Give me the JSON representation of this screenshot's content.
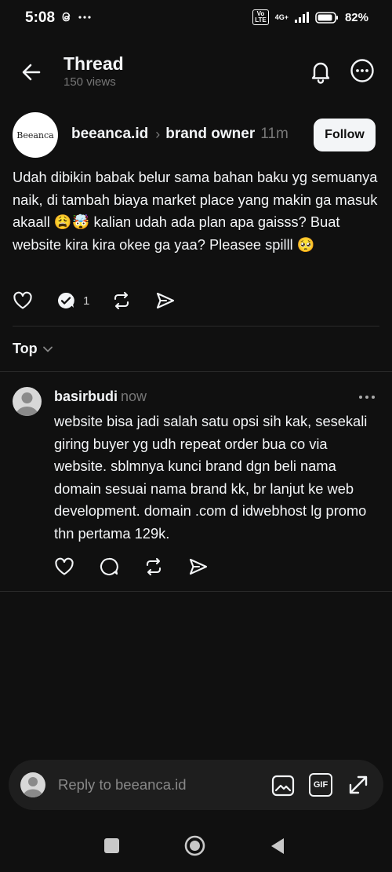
{
  "status_bar": {
    "time": "5:08",
    "volte": "Vo\nLTE",
    "network": "4G+",
    "battery": "82%"
  },
  "header": {
    "title": "Thread",
    "views": "150 views"
  },
  "post": {
    "avatar_text": "Beeanca",
    "username": "beeanca.id",
    "context": "brand owner",
    "time": "11m",
    "follow_label": "Follow",
    "text": "Udah dibikin babak belur sama bahan baku yg semuanya naik, di tambah biaya market place yang makin ga masuk akaall 😩🤯 kalian udah ada plan apa gaisss? Buat website kira kira okee ga yaa? Pleasee spilll 🥺",
    "reply_count": "1"
  },
  "sort": {
    "label": "Top"
  },
  "reply": {
    "username": "basirbudi",
    "time": "now",
    "text": "website bisa jadi salah satu opsi sih kak, sesekali giring buyer yg udh repeat order bua co via website. sblmnya kunci brand dgn beli nama domain sesuai nama brand kk, br lanjut ke web development. domain .com d idwebhost lg promo thn pertama 129k."
  },
  "composer": {
    "placeholder": "Reply to beeanca.id",
    "gif_label": "GIF"
  }
}
